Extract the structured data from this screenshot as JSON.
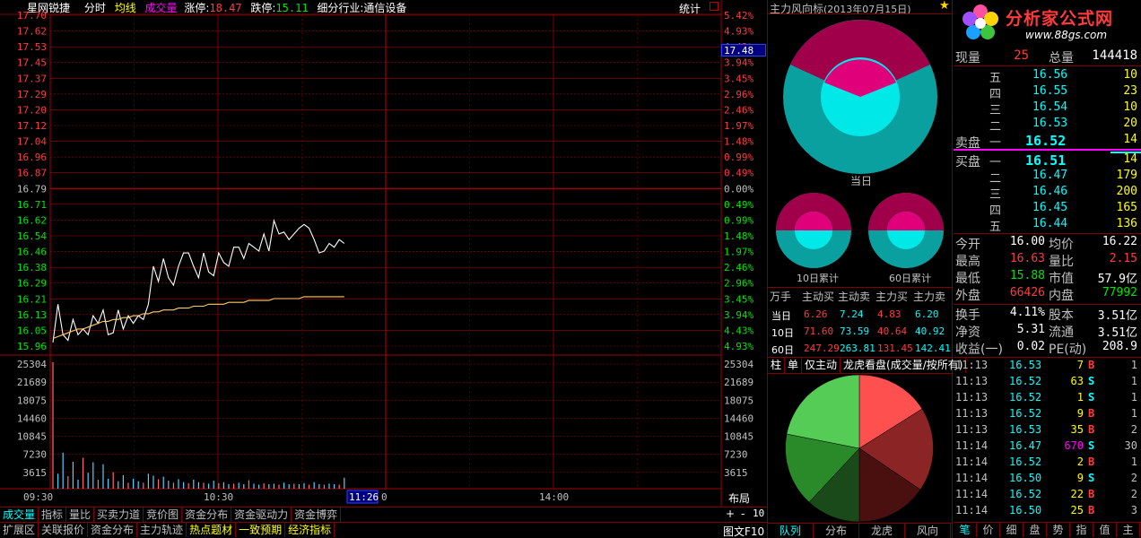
{
  "header": {
    "stock_name": "星网锐捷",
    "view_mode": "分时",
    "avg_line_label": "均线",
    "volume_label": "成交量",
    "limit_up_label": "涨停:",
    "limit_up_value": "18.47",
    "limit_down_label": "跌停:",
    "limit_down_value": "15.11",
    "industry_label": "细分行业:通信设备",
    "stats_label": "统计"
  },
  "price_axis": {
    "left_labels": [
      "17.70",
      "17.62",
      "17.53",
      "17.45",
      "17.37",
      "17.29",
      "17.20",
      "17.12",
      "17.04",
      "16.96",
      "16.87",
      "16.79",
      "16.71",
      "16.62",
      "16.54",
      "16.46",
      "16.38",
      "16.29",
      "16.21",
      "16.13",
      "16.05",
      "15.96"
    ],
    "right_labels": [
      "5.42%",
      "4.93%",
      "4.43%",
      "3.94%",
      "3.45%",
      "2.96%",
      "2.46%",
      "1.97%",
      "1.48%",
      "0.99%",
      "0.49%",
      "0.00%",
      "0.49%",
      "0.99%",
      "1.48%",
      "1.97%",
      "2.46%",
      "2.96%",
      "3.45%",
      "3.94%",
      "4.43%",
      "4.93%"
    ],
    "current_price_tag": "17.48"
  },
  "volume_axis": {
    "left_labels": [
      "25304",
      "21689",
      "18075",
      "14460",
      "10845",
      "7230",
      "3615"
    ],
    "right_labels": [
      "25304",
      "21689",
      "18075",
      "14460",
      "10845",
      "7230",
      "3615"
    ]
  },
  "time_axis": {
    "labels": [
      "09:30",
      "10:30",
      "11:26",
      "14:00"
    ],
    "current_time": "11:26"
  },
  "chart_data": {
    "type": "line",
    "title": "",
    "xlabel": "",
    "ylabel": "",
    "ylim": [
      15.96,
      17.7
    ],
    "x": [
      0,
      2,
      4,
      6,
      8,
      10,
      12,
      14,
      16,
      18,
      20,
      22,
      24,
      26,
      28,
      30,
      32,
      34,
      36,
      38,
      40,
      42,
      44,
      46,
      48,
      50,
      52,
      54,
      56,
      58,
      60,
      62,
      64,
      66,
      68,
      70,
      72,
      74,
      76,
      78,
      80,
      82,
      84,
      86,
      88,
      90,
      92,
      94,
      96,
      98,
      100,
      102,
      104,
      106,
      108,
      110,
      112,
      114,
      116
    ],
    "series": [
      {
        "values": [
          15.98,
          16.18,
          16.02,
          15.99,
          16.1,
          16.02,
          16.05,
          16.02,
          16.12,
          16.08,
          16.15,
          16.02,
          16.03,
          16.15,
          16.05,
          16.12,
          16.08,
          16.12,
          16.1,
          16.18,
          16.38,
          16.3,
          16.42,
          16.32,
          16.28,
          16.38,
          16.45,
          16.45,
          16.38,
          16.32,
          16.45,
          16.35,
          16.33,
          16.45,
          16.4,
          16.38,
          16.48,
          16.48,
          16.42,
          16.5,
          16.48,
          16.46,
          16.55,
          16.46,
          16.62,
          16.55,
          16.56,
          16.52,
          16.55,
          16.58,
          16.6,
          16.58,
          16.52,
          16.45,
          16.46,
          16.5,
          16.48,
          16.52,
          16.5
        ]
      },
      {
        "values": [
          16.0,
          16.01,
          16.02,
          16.03,
          16.04,
          16.05,
          16.05,
          16.06,
          16.07,
          16.08,
          16.09,
          16.09,
          16.1,
          16.1,
          16.11,
          16.11,
          16.12,
          16.12,
          16.13,
          16.13,
          16.14,
          16.14,
          16.15,
          16.15,
          16.15,
          16.16,
          16.16,
          16.16,
          16.17,
          16.17,
          16.17,
          16.18,
          16.18,
          16.18,
          16.18,
          16.19,
          16.19,
          16.19,
          16.19,
          16.2,
          16.2,
          16.2,
          16.2,
          16.2,
          16.21,
          16.21,
          16.21,
          16.21,
          16.21,
          16.21,
          16.22,
          16.22,
          16.22,
          16.22,
          16.22,
          16.22,
          16.22,
          16.22,
          16.22
        ]
      }
    ],
    "volume": [
      25304,
      3000,
      7200,
      2500,
      5400,
      1800,
      6200,
      3200,
      5300,
      1800,
      4900,
      2000,
      3300,
      1500,
      2700,
      1200,
      2000,
      1500,
      1200,
      3000,
      2600,
      1900,
      2400,
      1600,
      1200,
      1900,
      1300,
      1100,
      1800,
      1300,
      1200,
      1000,
      1600,
      1100,
      1300,
      900,
      1000,
      1200,
      900,
      1700,
      1000,
      800,
      1100,
      900,
      1000,
      800,
      1200,
      900,
      1000,
      900,
      1100,
      800,
      1300,
      900,
      800,
      1000,
      900,
      800,
      2200
    ]
  },
  "mid_panel": {
    "title": "主力风向标",
    "date": "(2013年07月15日)",
    "today_label": "当日",
    "d10_label": "10日累计",
    "d60_label": "60日累计",
    "table_headers": [
      "万手",
      "主动买",
      "主动卖",
      "主力买",
      "主力卖"
    ],
    "table_rows": [
      {
        "label": "当日",
        "v1": "6.26",
        "v2": "7.24",
        "v3": "4.83",
        "v4": "6.20"
      },
      {
        "label": "10日",
        "v1": "71.60",
        "v2": "73.59",
        "v3": "40.64",
        "v4": "40.92"
      },
      {
        "label": "60日",
        "v1": "247.29",
        "v2": "263.81",
        "v3": "131.45",
        "v4": "142.41"
      }
    ],
    "tabs": [
      "柱",
      "单",
      "仅主动",
      "龙虎看盘(成交量/按所有)"
    ],
    "bottom_tabs": [
      "队列",
      "分布",
      "龙虎",
      "风向"
    ],
    "colors": {
      "maroon": "#a0004a",
      "teal": "#0aa0a0",
      "cyan": "#00e8e8",
      "magenta": "#e0007a"
    }
  },
  "right_panel": {
    "logo_text": "分析家公式网",
    "logo_url": "www.88gs.com",
    "current_vol_label": "现量",
    "current_vol": "25",
    "total_vol_label": "总量",
    "total_vol": "144418",
    "sell_label": "卖盘",
    "buy_label": "买盘",
    "asks": [
      {
        "level": "五",
        "price": "16.56",
        "vol": "10"
      },
      {
        "level": "四",
        "price": "16.55",
        "vol": "23"
      },
      {
        "level": "三",
        "price": "16.54",
        "vol": "10"
      },
      {
        "level": "二",
        "price": "16.53",
        "vol": "20"
      },
      {
        "level": "一",
        "price": "16.52",
        "vol": "14"
      }
    ],
    "bids": [
      {
        "level": "一",
        "price": "16.51",
        "vol": "14"
      },
      {
        "level": "二",
        "price": "16.47",
        "vol": "179"
      },
      {
        "level": "三",
        "price": "16.46",
        "vol": "200"
      },
      {
        "level": "四",
        "price": "16.45",
        "vol": "165"
      },
      {
        "level": "五",
        "price": "16.44",
        "vol": "136"
      }
    ],
    "stats": [
      {
        "l1": "今开",
        "v1": "16.00",
        "l2": "均价",
        "v2": "16.22"
      },
      {
        "l1": "最高",
        "v1": "16.63",
        "l2": "量比",
        "v2": "2.15"
      },
      {
        "l1": "最低",
        "v1": "15.88",
        "l2": "市值",
        "v2": "57.9亿"
      },
      {
        "l1": "外盘",
        "v1": "66426",
        "l2": "内盘",
        "v2": "77992"
      }
    ],
    "fundamentals": [
      {
        "l1": "换手",
        "v1": "4.11%",
        "l2": "股本",
        "v2": "3.51亿"
      },
      {
        "l1": "净资",
        "v1": "5.31",
        "l2": "流通",
        "v2": "3.51亿"
      },
      {
        "l1": "收益(一)",
        "v1": "0.02",
        "l2": "PE(动)",
        "v2": "208.9"
      }
    ],
    "ticks": [
      {
        "time": "11:13",
        "price": "16.53",
        "vol": "7",
        "side": "B",
        "n": "1"
      },
      {
        "time": "11:13",
        "price": "16.52",
        "vol": "63",
        "side": "S",
        "n": "1"
      },
      {
        "time": "11:13",
        "price": "16.52",
        "vol": "1",
        "side": "S",
        "n": "1"
      },
      {
        "time": "11:13",
        "price": "16.52",
        "vol": "9",
        "side": "B",
        "n": "1"
      },
      {
        "time": "11:13",
        "price": "16.53",
        "vol": "35",
        "side": "B",
        "n": "2"
      },
      {
        "time": "11:14",
        "price": "16.47",
        "vol": "670",
        "side": "S",
        "n": "30"
      },
      {
        "time": "11:14",
        "price": "16.52",
        "vol": "2",
        "side": "B",
        "n": "1"
      },
      {
        "time": "11:14",
        "price": "16.50",
        "vol": "9",
        "side": "S",
        "n": "2"
      },
      {
        "time": "11:14",
        "price": "16.52",
        "vol": "22",
        "side": "B",
        "n": "2"
      },
      {
        "time": "11:14",
        "price": "16.50",
        "vol": "25",
        "side": "B",
        "n": "3"
      }
    ],
    "bottom_tabs": [
      "笔",
      "价",
      "细",
      "盘",
      "势",
      "指",
      "值",
      "主"
    ]
  },
  "bottom_bar": {
    "row1": [
      "成交量",
      "指标",
      "量比",
      "买卖力道",
      "竞价图",
      "资金分布",
      "资金驱动力",
      "资金博弈"
    ],
    "row2": [
      "扩展区",
      "关联报价",
      "资金分布",
      "主力轨迹",
      "热点题材",
      "一致预期",
      "经济指标"
    ],
    "layout_btn": "布局",
    "plus_btn": "+",
    "minus_btn": "-",
    "number_btn": "10",
    "figure_btn": "图文F10"
  }
}
